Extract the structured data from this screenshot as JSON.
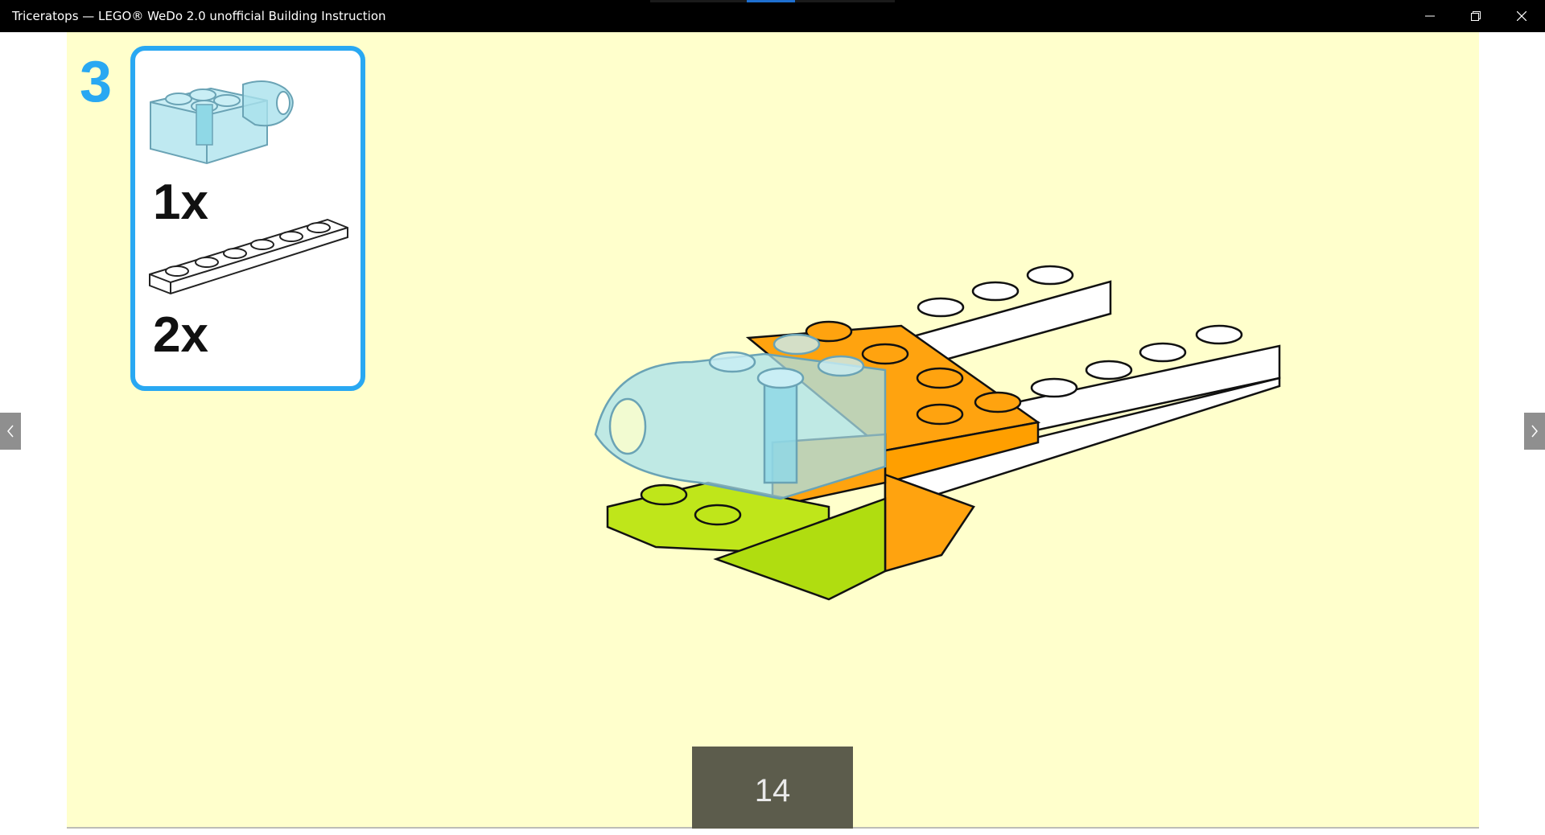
{
  "window": {
    "title": "Triceratops — LEGO® WeDo 2.0 unofficial Building Instruction",
    "controls": [
      "minimize-icon",
      "restore-icon",
      "close-icon"
    ]
  },
  "loading_indicator": {
    "color": "#1e6fd0"
  },
  "instruction": {
    "step_number": "3",
    "parts": [
      {
        "icon": "transparent-light-blue-brick-with-pin-hole",
        "quantity": "1x"
      },
      {
        "icon": "white-1x6-plate",
        "quantity": "2x"
      }
    ],
    "model_image": "triceratops-head-assembly"
  },
  "navigation": {
    "prev_icon": "chevron-left-icon",
    "next_icon": "chevron-right-icon"
  },
  "page_number": "14",
  "colors": {
    "page_background": "#ffffcc",
    "step_accent": "#29a8f2",
    "page_number_bg": "#5c5c4c",
    "brick_orange": "#ffa30f",
    "brick_lime": "#bfe61a",
    "brick_transparent_blue": "#a9e1ec"
  }
}
